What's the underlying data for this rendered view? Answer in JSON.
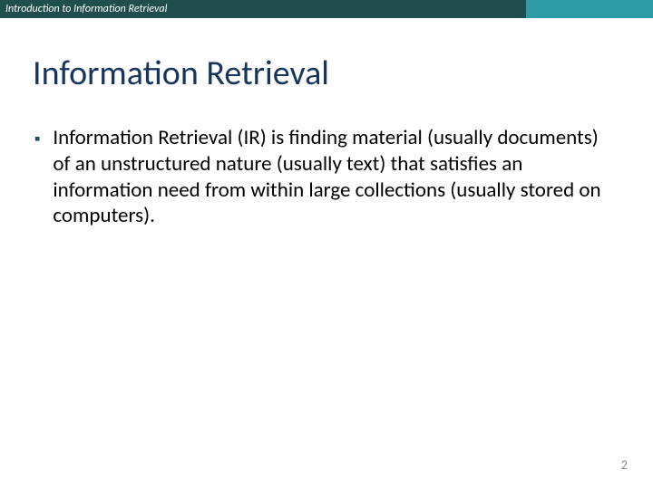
{
  "header": {
    "label": "Introduction to Information Retrieval"
  },
  "slide": {
    "title": "Information Retrieval",
    "bullets": [
      {
        "text": "Information Retrieval (IR) is finding material (usually documents) of an unstructured nature (usually text) that satisfies an information need from within large collections (usually stored on computers)."
      }
    ],
    "page_number": "2"
  }
}
